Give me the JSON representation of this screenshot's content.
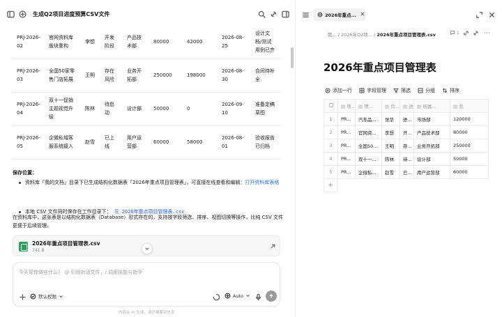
{
  "left": {
    "title": "生成Q2项目进度预算CSV文件",
    "table_rows": [
      {
        "cells": [
          "PRJ-2026-02",
          "官网资料库版块重构",
          "李想",
          "开发阶段",
          "产品技术部",
          "80000",
          "42000",
          "2026-08-25",
          "设计文档/测试用例已齐"
        ]
      },
      {
        "cells": [
          "PRJ-2026-03",
          "全国50家零售门店拓展",
          "王明",
          "存在风险",
          "业务开拓部",
          "250000",
          "198000",
          "2026-08-30",
          "合同待补全"
        ]
      },
      {
        "cells": [
          "PRJ-2026-04",
          "双十一促销主题视觉升级",
          "陈林",
          "待启动",
          "设计部",
          "50000",
          "0",
          "2026-09-10",
          "准备定稿草图"
        ]
      },
      {
        "cells": [
          "PRJ-2026-05",
          "企微私域客服系统接入",
          "赵雪",
          "已上线",
          "用户运营部",
          "60000",
          "58000",
          "2026-08-01",
          "验收报告已归档"
        ]
      }
    ],
    "save_heading": "保存位置：",
    "bullet1_text": "资料库「我的文档」目录下已生成结构化数据表「2026年重点项目管理表」，可直接在线查看和编辑：",
    "bullet1_link": "打开资料库表格",
    "bullet2_text": "本地 CSV 文件同时保存在工作目录下：",
    "bullet2_code": "2026年重点项目管理表.csv",
    "para": "在资料库中，这张表是以结构化数据表（Database）形式存在的，支持按字段筛选、排序、视图切换等操作，比纯 CSV 文件更便于后续管理。",
    "file_name": "2026年重点项目管理表.csv",
    "file_size": "741 B",
    "input_placeholder": "今天帮你做些什么？ @ 引用对话文件，/ 调用技能与指令",
    "permission_label": "默认权限",
    "model_label": "Auto",
    "footer_note": "内容由 AI 生成，请仔细鉴别信息"
  },
  "right": {
    "tab_label": "2026年重点...",
    "crumbs": [
      "我...",
      "2026年Q2项...",
      "2026年重点项目管理表.csv"
    ],
    "comment_count": "1",
    "doc_title": "2026年重点项目管理表",
    "toolbar": {
      "add_row": "添加一行",
      "fields": "字段管理",
      "filter": "筛选",
      "group": "分组",
      "sort": "排序"
    },
    "header_cells": [
      "项...",
      "项...",
      "负...",
      "进...",
      "所属...",
      "总"
    ],
    "rows": [
      {
        "num": "1",
        "cells": [
          "PR...",
          "汽车品...",
          "张华",
          "进...",
          "市场部",
          "120000"
        ]
      },
      {
        "num": "2",
        "cells": [
          "PR...",
          "官网资...",
          "李想",
          "开...",
          "产品技术部",
          "80000"
        ]
      },
      {
        "num": "3",
        "cells": [
          "PR...",
          "全国50...",
          "王明",
          "存...",
          "业务开拓部",
          "250000"
        ]
      },
      {
        "num": "4",
        "cells": [
          "PR...",
          "双十一...",
          "陈林",
          "待...",
          "设计部",
          "50000"
        ]
      },
      {
        "num": "5",
        "cells": [
          "PR...",
          "企微私...",
          "赵雪",
          "已...",
          "用户运营部",
          "60000"
        ]
      }
    ],
    "add_symbol": "+"
  }
}
